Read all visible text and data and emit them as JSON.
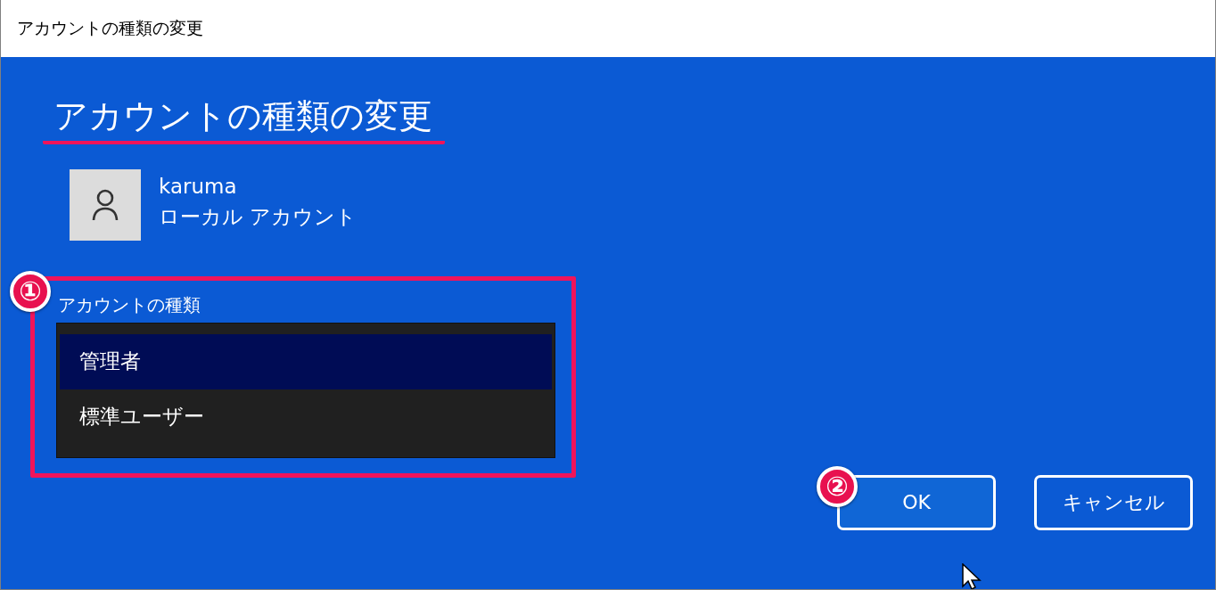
{
  "window": {
    "title": "アカウントの種類の変更"
  },
  "heading": "アカウントの種類の変更",
  "account": {
    "name": "karuma",
    "type": "ローカル アカウント"
  },
  "account_type": {
    "label": "アカウントの種類",
    "options": [
      {
        "label": "管理者",
        "selected": true
      },
      {
        "label": "標準ユーザー",
        "selected": false
      }
    ]
  },
  "buttons": [
    {
      "label": "OK",
      "kind": "primary"
    },
    {
      "label": "キャンセル",
      "kind": "secondary"
    }
  ],
  "annotations": [
    {
      "label": "①"
    },
    {
      "label": "②"
    }
  ]
}
